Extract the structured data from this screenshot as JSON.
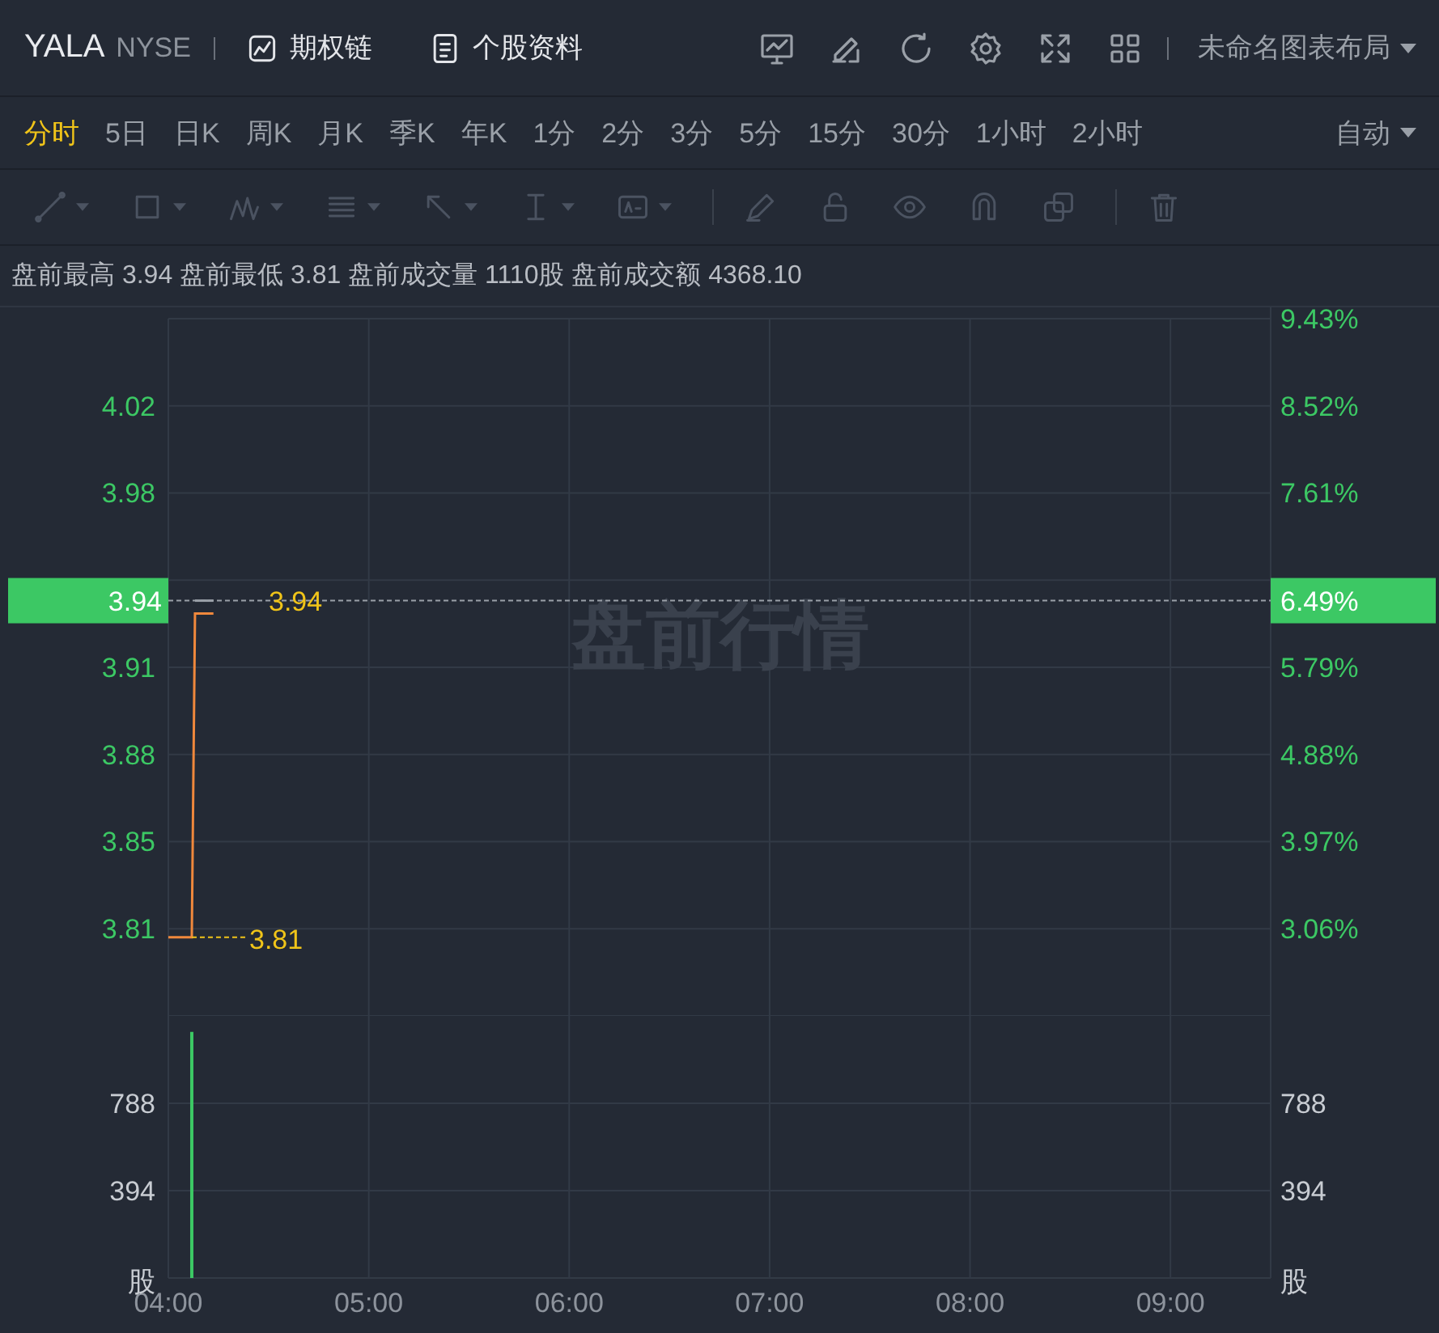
{
  "header": {
    "symbol": "YALA",
    "exchange": "NYSE",
    "links": [
      {
        "label": "期权链",
        "kind": "options"
      },
      {
        "label": "个股资料",
        "kind": "profile"
      }
    ],
    "layout_menu": "未命名图表布局"
  },
  "timeframes": [
    {
      "label": "分时",
      "selected": true
    },
    {
      "label": "5日",
      "selected": false
    },
    {
      "label": "日K",
      "selected": false
    },
    {
      "label": "周K",
      "selected": false
    },
    {
      "label": "月K",
      "selected": false
    },
    {
      "label": "季K",
      "selected": false
    },
    {
      "label": "年K",
      "selected": false
    },
    {
      "label": "1分",
      "selected": false
    },
    {
      "label": "2分",
      "selected": false
    },
    {
      "label": "3分",
      "selected": false
    },
    {
      "label": "5分",
      "selected": false
    },
    {
      "label": "15分",
      "selected": false
    },
    {
      "label": "30分",
      "selected": false
    },
    {
      "label": "1小时",
      "selected": false
    },
    {
      "label": "2小时",
      "selected": false
    }
  ],
  "mode_menu": "自动",
  "premarket_summary": "盘前最高 3.94 盘前最低 3.81 盘前成交量 1110股 盘前成交额 4368.10",
  "price_chart": {
    "watermark": "盘前行情",
    "last_price": "3.94",
    "last_change": "6.49%",
    "high_label": "3.94",
    "low_label": "3.81",
    "right_axis": [
      "9.43%",
      "8.52%",
      "7.61%",
      "5.79%",
      "4.88%",
      "3.97%",
      "3.06%"
    ],
    "chart_data": {
      "type": "line",
      "x": [
        4,
        4.117,
        4.133,
        4.225
      ],
      "series": [
        {
          "color": "#f0883c",
          "values": [
            3.81,
            3.81,
            3.935,
            3.935
          ]
        },
        {
          "color": "#9aa0a8",
          "values": [
            null,
            null,
            3.94,
            3.94
          ]
        }
      ],
      "xlim": [
        4,
        9.5
      ],
      "ylim": [
        3.7796,
        4.0489
      ],
      "grid": true,
      "yticks": [
        {
          "value": 4.0152,
          "label": "4.02"
        },
        {
          "value": 3.9816,
          "label": "3.98"
        },
        {
          "value": 3.9143,
          "label": "3.91"
        },
        {
          "value": 3.8806,
          "label": "3.88"
        },
        {
          "value": 3.847,
          "label": "3.85"
        },
        {
          "value": 3.8133,
          "label": "3.81"
        }
      ]
    }
  },
  "volume_chart": {
    "unit_left": "股",
    "unit_right": "股",
    "right_axis": [
      "788",
      "394"
    ],
    "chart_data": {
      "type": "bar",
      "x": [
        4.117
      ],
      "series": [
        {
          "color": "#3cc864",
          "values": [
            1110
          ]
        }
      ],
      "xlim": [
        4,
        9.5
      ],
      "ylim": [
        0,
        1182
      ],
      "grid": true,
      "xticks": [
        {
          "value": 4,
          "label": "04:00"
        },
        {
          "value": 5,
          "label": "05:00"
        },
        {
          "value": 6,
          "label": "06:00"
        },
        {
          "value": 7,
          "label": "07:00"
        },
        {
          "value": 8,
          "label": "08:00"
        },
        {
          "value": 9,
          "label": "09:00"
        }
      ],
      "yticks": [
        {
          "value": 788,
          "label": "788"
        },
        {
          "value": 394,
          "label": "394"
        }
      ]
    }
  }
}
